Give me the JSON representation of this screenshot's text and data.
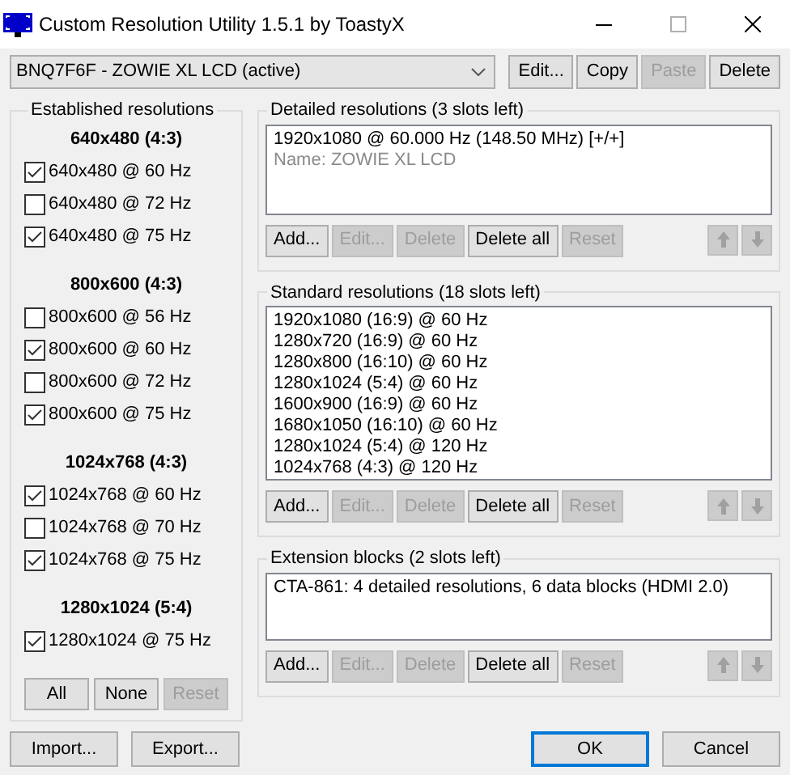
{
  "window": {
    "title": "Custom Resolution Utility 1.5.1 by ToastyX"
  },
  "device_select": {
    "value": "BNQ7F6F - ZOWIE XL LCD (active)"
  },
  "top_buttons": [
    {
      "label": "Edit...",
      "disabled": false
    },
    {
      "label": "Copy",
      "disabled": false
    },
    {
      "label": "Paste",
      "disabled": true
    },
    {
      "label": "Delete",
      "disabled": false
    }
  ],
  "established": {
    "title": "Established resolutions",
    "groups": [
      {
        "heading": "640x480 (4:3)",
        "items": [
          {
            "label": "640x480 @ 60 Hz",
            "checked": true
          },
          {
            "label": "640x480 @ 72 Hz",
            "checked": false
          },
          {
            "label": "640x480 @ 75 Hz",
            "checked": true
          }
        ]
      },
      {
        "heading": "800x600 (4:3)",
        "items": [
          {
            "label": "800x600 @ 56 Hz",
            "checked": false
          },
          {
            "label": "800x600 @ 60 Hz",
            "checked": true
          },
          {
            "label": "800x600 @ 72 Hz",
            "checked": false
          },
          {
            "label": "800x600 @ 75 Hz",
            "checked": true
          }
        ]
      },
      {
        "heading": "1024x768 (4:3)",
        "items": [
          {
            "label": "1024x768 @ 60 Hz",
            "checked": true
          },
          {
            "label": "1024x768 @ 70 Hz",
            "checked": false
          },
          {
            "label": "1024x768 @ 75 Hz",
            "checked": true
          }
        ]
      },
      {
        "heading": "1280x1024 (5:4)",
        "items": [
          {
            "label": "1280x1024 @ 75 Hz",
            "checked": true
          }
        ]
      }
    ],
    "buttons": [
      {
        "label": "All",
        "disabled": false
      },
      {
        "label": "None",
        "disabled": false
      },
      {
        "label": "Reset",
        "disabled": true
      }
    ]
  },
  "panels": [
    {
      "title": "Detailed resolutions (3 slots left)",
      "lines": [
        {
          "text": "1920x1080 @ 60.000 Hz (148.50 MHz) [+/+]",
          "kind": "entry"
        },
        {
          "text": "Name: ZOWIE XL LCD",
          "kind": "note"
        }
      ],
      "buttons": [
        {
          "label": "Add...",
          "disabled": false
        },
        {
          "label": "Edit...",
          "disabled": true
        },
        {
          "label": "Delete",
          "disabled": true
        },
        {
          "label": "Delete all",
          "disabled": false
        },
        {
          "label": "Reset",
          "disabled": true
        }
      ],
      "arrows_disabled": true
    },
    {
      "title": "Standard resolutions (18 slots left)",
      "lines": [
        {
          "text": "1920x1080 (16:9) @ 60 Hz",
          "kind": "entry"
        },
        {
          "text": "1280x720 (16:9) @ 60 Hz",
          "kind": "entry"
        },
        {
          "text": "1280x800 (16:10) @ 60 Hz",
          "kind": "entry"
        },
        {
          "text": "1280x1024 (5:4) @ 60 Hz",
          "kind": "entry"
        },
        {
          "text": "1600x900 (16:9) @ 60 Hz",
          "kind": "entry"
        },
        {
          "text": "1680x1050 (16:10) @ 60 Hz",
          "kind": "entry"
        },
        {
          "text": "1280x1024 (5:4) @ 120 Hz",
          "kind": "entry"
        },
        {
          "text": "1024x768 (4:3) @ 120 Hz",
          "kind": "entry"
        }
      ],
      "buttons": [
        {
          "label": "Add...",
          "disabled": false
        },
        {
          "label": "Edit...",
          "disabled": true
        },
        {
          "label": "Delete",
          "disabled": true
        },
        {
          "label": "Delete all",
          "disabled": false
        },
        {
          "label": "Reset",
          "disabled": true
        }
      ],
      "arrows_disabled": true
    },
    {
      "title": "Extension blocks (2 slots left)",
      "lines": [
        {
          "text": "CTA-861: 4 detailed resolutions, 6 data blocks (HDMI 2.0)",
          "kind": "entry"
        }
      ],
      "buttons": [
        {
          "label": "Add...",
          "disabled": false
        },
        {
          "label": "Edit...",
          "disabled": true
        },
        {
          "label": "Delete",
          "disabled": true
        },
        {
          "label": "Delete all",
          "disabled": false
        },
        {
          "label": "Reset",
          "disabled": true
        }
      ],
      "arrows_disabled": true
    }
  ],
  "footer": {
    "left": [
      {
        "label": "Import...",
        "default": false
      },
      {
        "label": "Export...",
        "default": false
      }
    ],
    "right": [
      {
        "label": "OK",
        "default": true
      },
      {
        "label": "Cancel",
        "default": false
      }
    ]
  }
}
